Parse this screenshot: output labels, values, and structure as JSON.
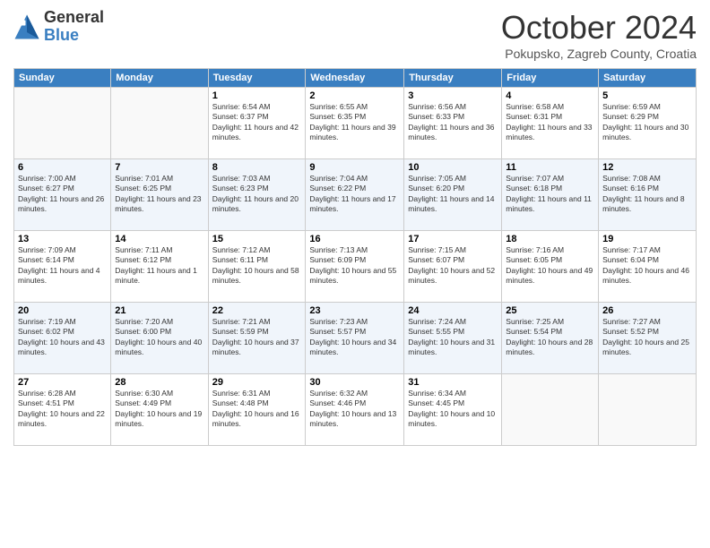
{
  "header": {
    "logo_general": "General",
    "logo_blue": "Blue",
    "month_title": "October 2024",
    "location": "Pokupsko, Zagreb County, Croatia"
  },
  "days_of_week": [
    "Sunday",
    "Monday",
    "Tuesday",
    "Wednesday",
    "Thursday",
    "Friday",
    "Saturday"
  ],
  "weeks": [
    [
      {
        "num": "",
        "sunrise": "",
        "sunset": "",
        "daylight": ""
      },
      {
        "num": "",
        "sunrise": "",
        "sunset": "",
        "daylight": ""
      },
      {
        "num": "1",
        "sunrise": "Sunrise: 6:54 AM",
        "sunset": "Sunset: 6:37 PM",
        "daylight": "Daylight: 11 hours and 42 minutes."
      },
      {
        "num": "2",
        "sunrise": "Sunrise: 6:55 AM",
        "sunset": "Sunset: 6:35 PM",
        "daylight": "Daylight: 11 hours and 39 minutes."
      },
      {
        "num": "3",
        "sunrise": "Sunrise: 6:56 AM",
        "sunset": "Sunset: 6:33 PM",
        "daylight": "Daylight: 11 hours and 36 minutes."
      },
      {
        "num": "4",
        "sunrise": "Sunrise: 6:58 AM",
        "sunset": "Sunset: 6:31 PM",
        "daylight": "Daylight: 11 hours and 33 minutes."
      },
      {
        "num": "5",
        "sunrise": "Sunrise: 6:59 AM",
        "sunset": "Sunset: 6:29 PM",
        "daylight": "Daylight: 11 hours and 30 minutes."
      }
    ],
    [
      {
        "num": "6",
        "sunrise": "Sunrise: 7:00 AM",
        "sunset": "Sunset: 6:27 PM",
        "daylight": "Daylight: 11 hours and 26 minutes."
      },
      {
        "num": "7",
        "sunrise": "Sunrise: 7:01 AM",
        "sunset": "Sunset: 6:25 PM",
        "daylight": "Daylight: 11 hours and 23 minutes."
      },
      {
        "num": "8",
        "sunrise": "Sunrise: 7:03 AM",
        "sunset": "Sunset: 6:23 PM",
        "daylight": "Daylight: 11 hours and 20 minutes."
      },
      {
        "num": "9",
        "sunrise": "Sunrise: 7:04 AM",
        "sunset": "Sunset: 6:22 PM",
        "daylight": "Daylight: 11 hours and 17 minutes."
      },
      {
        "num": "10",
        "sunrise": "Sunrise: 7:05 AM",
        "sunset": "Sunset: 6:20 PM",
        "daylight": "Daylight: 11 hours and 14 minutes."
      },
      {
        "num": "11",
        "sunrise": "Sunrise: 7:07 AM",
        "sunset": "Sunset: 6:18 PM",
        "daylight": "Daylight: 11 hours and 11 minutes."
      },
      {
        "num": "12",
        "sunrise": "Sunrise: 7:08 AM",
        "sunset": "Sunset: 6:16 PM",
        "daylight": "Daylight: 11 hours and 8 minutes."
      }
    ],
    [
      {
        "num": "13",
        "sunrise": "Sunrise: 7:09 AM",
        "sunset": "Sunset: 6:14 PM",
        "daylight": "Daylight: 11 hours and 4 minutes."
      },
      {
        "num": "14",
        "sunrise": "Sunrise: 7:11 AM",
        "sunset": "Sunset: 6:12 PM",
        "daylight": "Daylight: 11 hours and 1 minute."
      },
      {
        "num": "15",
        "sunrise": "Sunrise: 7:12 AM",
        "sunset": "Sunset: 6:11 PM",
        "daylight": "Daylight: 10 hours and 58 minutes."
      },
      {
        "num": "16",
        "sunrise": "Sunrise: 7:13 AM",
        "sunset": "Sunset: 6:09 PM",
        "daylight": "Daylight: 10 hours and 55 minutes."
      },
      {
        "num": "17",
        "sunrise": "Sunrise: 7:15 AM",
        "sunset": "Sunset: 6:07 PM",
        "daylight": "Daylight: 10 hours and 52 minutes."
      },
      {
        "num": "18",
        "sunrise": "Sunrise: 7:16 AM",
        "sunset": "Sunset: 6:05 PM",
        "daylight": "Daylight: 10 hours and 49 minutes."
      },
      {
        "num": "19",
        "sunrise": "Sunrise: 7:17 AM",
        "sunset": "Sunset: 6:04 PM",
        "daylight": "Daylight: 10 hours and 46 minutes."
      }
    ],
    [
      {
        "num": "20",
        "sunrise": "Sunrise: 7:19 AM",
        "sunset": "Sunset: 6:02 PM",
        "daylight": "Daylight: 10 hours and 43 minutes."
      },
      {
        "num": "21",
        "sunrise": "Sunrise: 7:20 AM",
        "sunset": "Sunset: 6:00 PM",
        "daylight": "Daylight: 10 hours and 40 minutes."
      },
      {
        "num": "22",
        "sunrise": "Sunrise: 7:21 AM",
        "sunset": "Sunset: 5:59 PM",
        "daylight": "Daylight: 10 hours and 37 minutes."
      },
      {
        "num": "23",
        "sunrise": "Sunrise: 7:23 AM",
        "sunset": "Sunset: 5:57 PM",
        "daylight": "Daylight: 10 hours and 34 minutes."
      },
      {
        "num": "24",
        "sunrise": "Sunrise: 7:24 AM",
        "sunset": "Sunset: 5:55 PM",
        "daylight": "Daylight: 10 hours and 31 minutes."
      },
      {
        "num": "25",
        "sunrise": "Sunrise: 7:25 AM",
        "sunset": "Sunset: 5:54 PM",
        "daylight": "Daylight: 10 hours and 28 minutes."
      },
      {
        "num": "26",
        "sunrise": "Sunrise: 7:27 AM",
        "sunset": "Sunset: 5:52 PM",
        "daylight": "Daylight: 10 hours and 25 minutes."
      }
    ],
    [
      {
        "num": "27",
        "sunrise": "Sunrise: 6:28 AM",
        "sunset": "Sunset: 4:51 PM",
        "daylight": "Daylight: 10 hours and 22 minutes."
      },
      {
        "num": "28",
        "sunrise": "Sunrise: 6:30 AM",
        "sunset": "Sunset: 4:49 PM",
        "daylight": "Daylight: 10 hours and 19 minutes."
      },
      {
        "num": "29",
        "sunrise": "Sunrise: 6:31 AM",
        "sunset": "Sunset: 4:48 PM",
        "daylight": "Daylight: 10 hours and 16 minutes."
      },
      {
        "num": "30",
        "sunrise": "Sunrise: 6:32 AM",
        "sunset": "Sunset: 4:46 PM",
        "daylight": "Daylight: 10 hours and 13 minutes."
      },
      {
        "num": "31",
        "sunrise": "Sunrise: 6:34 AM",
        "sunset": "Sunset: 4:45 PM",
        "daylight": "Daylight: 10 hours and 10 minutes."
      },
      {
        "num": "",
        "sunrise": "",
        "sunset": "",
        "daylight": ""
      },
      {
        "num": "",
        "sunrise": "",
        "sunset": "",
        "daylight": ""
      }
    ]
  ]
}
